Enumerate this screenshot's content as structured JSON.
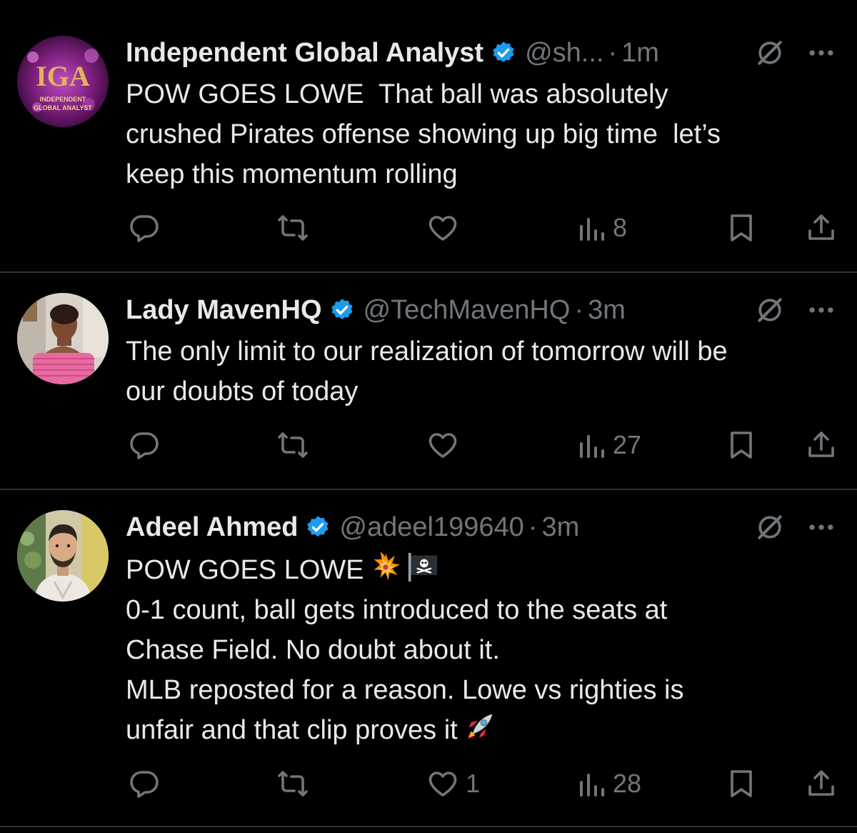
{
  "tweets": [
    {
      "author": "Independent Global Analyst",
      "handle": "@sh...",
      "separator": "·",
      "time": "1m",
      "avatar_icon": "iga-logo-avatar",
      "avatar_text": "IGA",
      "avatar_subtitle": "INDEPENDENT GLOBAL ANALYST",
      "lines": [
        "POW GOES LOWE  That ball was absolutely",
        "crushed Pirates offense showing up big time  let’s",
        "keep this momentum rolling"
      ],
      "likes": "",
      "views": "8"
    },
    {
      "author": "Lady MavenHQ",
      "handle": "@TechMavenHQ",
      "separator": "·",
      "time": "3m",
      "avatar_icon": "person-photo-avatar",
      "lines": [
        "The only limit to our realization of tomorrow will be",
        "our doubts of today"
      ],
      "likes": "",
      "views": "27"
    },
    {
      "author": "Adeel Ahmed",
      "handle": "@adeel199640",
      "separator": "·",
      "time": "3m",
      "avatar_icon": "cartoon-man-avatar",
      "first_line": "POW GOES LOWE",
      "lines": [
        "0-1 count, ball gets introduced to the seats at",
        "Chase Field. No doubt about it.",
        "MLB reposted for a reason. Lowe vs righties is",
        "unfair and that clip proves it"
      ],
      "likes": "1",
      "views": "28"
    }
  ],
  "icons": {
    "verified": "verified-badge-icon",
    "grok": "grok-icon",
    "more": "more-icon",
    "reply": "reply-icon",
    "repost": "repost-icon",
    "like": "like-icon",
    "views": "views-icon",
    "bookmark": "bookmark-icon",
    "share": "share-icon",
    "emoji_collision": "collision-emoji",
    "emoji_pirate_flag": "pirate-flag-emoji",
    "emoji_rocket": "rocket-emoji"
  },
  "colors": {
    "background": "#000000",
    "text": "#e7e9ea",
    "muted": "#71767b",
    "divider": "#2f3336",
    "verified": "#1d9bf0"
  }
}
